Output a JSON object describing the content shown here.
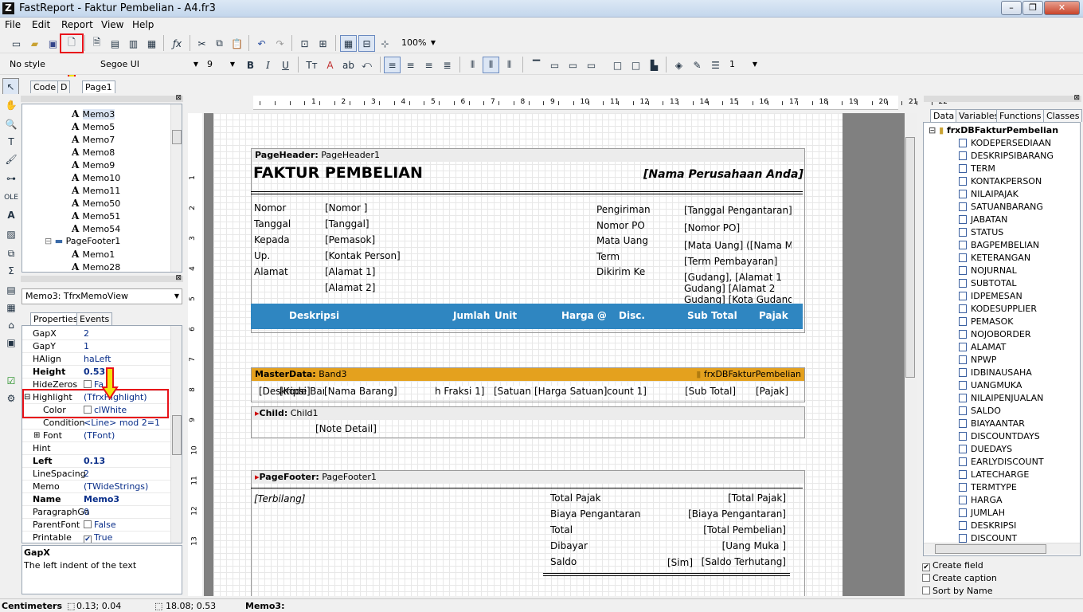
{
  "window": {
    "app_icon": "Z",
    "title": "FastReport - Faktur Pembelian - A4.fr3",
    "min": "–",
    "max": "❐",
    "close": "✕"
  },
  "menu": [
    "File",
    "Edit",
    "Report",
    "View",
    "Help"
  ],
  "toolbar": {
    "zoom": "100%",
    "style": "No style",
    "font": "Segoe UI",
    "size": "9",
    "bold": "B",
    "italic": "I",
    "underline": "U",
    "frame_width": "1"
  },
  "tabs": {
    "code": "Code",
    "data": "D",
    "page1": "Page1"
  },
  "tree": {
    "memos": [
      "Memo3",
      "Memo5",
      "Memo7",
      "Memo8",
      "Memo9",
      "Memo10",
      "Memo11",
      "Memo50",
      "Memo51",
      "Memo54"
    ],
    "footer": "PageFooter1",
    "footer_memos": [
      "Memo1",
      "Memo28"
    ]
  },
  "object_selector": "Memo3: TfrxMemoView",
  "inspector_tabs": {
    "props": "Properties",
    "events": "Events"
  },
  "properties": [
    {
      "name": "GapX",
      "value": "2",
      "bold": false
    },
    {
      "name": "GapY",
      "value": "1",
      "bold": false
    },
    {
      "name": "HAlign",
      "value": "haLeft",
      "bold": false
    },
    {
      "name": "Height",
      "value": "0.53",
      "bold": true
    },
    {
      "name": "HideZeros",
      "value": "Fa",
      "bold": false,
      "check": true
    },
    {
      "name": "Highlight",
      "value": "(TfrxHighlight)",
      "bold": false,
      "expand": "−"
    },
    {
      "name": "Color",
      "value": "clWhite",
      "bold": false,
      "check": true,
      "indent": true
    },
    {
      "name": "Condition",
      "value": "<Line> mod 2=1",
      "bold": false,
      "indent": true
    },
    {
      "name": "Font",
      "value": "(TFont)",
      "bold": false,
      "expand": "+",
      "indent": true
    },
    {
      "name": "Hint",
      "value": "",
      "bold": false
    },
    {
      "name": "Left",
      "value": "0.13",
      "bold": true
    },
    {
      "name": "LineSpacing",
      "value": "2",
      "bold": false
    },
    {
      "name": "Memo",
      "value": "(TWideStrings)",
      "bold": false
    },
    {
      "name": "Name",
      "value": "Memo3",
      "bold": true
    },
    {
      "name": "ParagraphGa",
      "value": "0",
      "bold": false
    },
    {
      "name": "ParentFont",
      "value": "False",
      "bold": false,
      "check": true
    },
    {
      "name": "Printable",
      "value": "True",
      "bold": false,
      "check": true,
      "checked": true
    }
  ],
  "help": {
    "title": "GapX",
    "text": "The left indent of the text"
  },
  "ruler": [
    "1",
    "2",
    "3",
    "4",
    "5",
    "6",
    "7",
    "8",
    "9",
    "10",
    "11",
    "12",
    "13",
    "14",
    "15",
    "16",
    "17",
    "18",
    "19",
    "20",
    "21",
    "22"
  ],
  "vruler": [
    "1",
    "2",
    "3",
    "4",
    "5",
    "6",
    "7",
    "8",
    "9",
    "10",
    "11",
    "12",
    "13"
  ],
  "report": {
    "page_header": {
      "label": "PageHeader:",
      "name": "PageHeader1"
    },
    "title": "FAKTUR PEMBELIAN",
    "company": "[Nama Perusahaan Anda]",
    "left_labels": [
      "Nomor",
      "Tanggal",
      "Kepada",
      "Up.",
      "Alamat"
    ],
    "left_values": [
      "[Nomor ]",
      "[Tanggal]",
      "[Pemasok]",
      "[Kontak Person]",
      "[Alamat 1]",
      "[Alamat 2]"
    ],
    "right_labels": [
      "Pengiriman",
      "Nomor PO",
      "Mata Uang",
      "Term",
      "Dikirim Ke"
    ],
    "right_values": [
      "[Tanggal Pengantaran]",
      "[Nomor PO]",
      "[Mata Uang] ([Nama Mata",
      "[Term Pembayaran]",
      "[Gudang], [Alamat 1",
      "Gudang] [Alamat 2",
      "Gudang] [Kota Gudang]"
    ],
    "columns": [
      "Deskripsi",
      "Jumlah",
      "Unit",
      "Harga @",
      "Disc.",
      "Sub Total",
      "Pajak"
    ],
    "master": {
      "label": "MasterData:",
      "name": "Band3",
      "dataset": "frxDBFakturPembelian"
    },
    "master_fields": [
      "[Deskripsi]",
      "[Kode Barang]",
      "[Nama Barang]",
      "h Fraksi 1]",
      "[Satuan",
      "[Harga Satuan]",
      "count 1]",
      "[Sub Total]",
      "[Pajak]"
    ],
    "child": {
      "label": "Child:",
      "name": "Child1"
    },
    "child_field": "[Note Detail]",
    "footer": {
      "label": "PageFooter:",
      "name": "PageFooter1"
    },
    "terbilang": "[Terbilang]",
    "footer_labels": [
      "Total Pajak",
      "Biaya Pengantaran",
      "Total",
      "Dibayar",
      "Saldo"
    ],
    "footer_values": [
      "[Total Pajak]",
      "[Biaya Pengantaran]",
      "[Total Pembelian]",
      "[Uang Muka ]",
      "[Saldo Terhutang]"
    ],
    "sim": "[Sim]"
  },
  "data_tabs": [
    "Data",
    "Variables",
    "Functions",
    "Classes"
  ],
  "dataset": "frxDBFakturPembelian",
  "fields": [
    "KODEPERSEDIAAN",
    "DESKRIPSIBARANG",
    "TERM",
    "KONTAKPERSON",
    "NILAIPAJAK",
    "SATUANBARANG",
    "JABATAN",
    "STATUS",
    "BAGPEMBELIAN",
    "KETERANGAN",
    "NOJURNAL",
    "SUBTOTAL",
    "IDPEMESAN",
    "KODESUPPLIER",
    "PEMASOK",
    "NOJOBORDER",
    "ALAMAT",
    "NPWP",
    "IDBINAUSAHA",
    "UANGMUKA",
    "NILAIPENJUALAN",
    "SALDO",
    "BIAYAANTAR",
    "DISCOUNTDAYS",
    "DUEDAYS",
    "EARLYDISCOUNT",
    "LATECHARGE",
    "TERMTYPE",
    "HARGA",
    "JUMLAH",
    "DESKRIPSI",
    "DISCOUNT"
  ],
  "options": {
    "create_field": "Create field",
    "create_caption": "Create caption",
    "sort": "Sort by Name"
  },
  "status": {
    "units": "Centimeters",
    "pos": "0.13; 0.04",
    "size": "18.08; 0.53",
    "obj": "Memo3:"
  },
  "colors": {
    "accent_red": "#e8121a",
    "arrow": "#f2e30c",
    "header_blue": "#2f86c1",
    "band_gold": "#e4a11e"
  }
}
